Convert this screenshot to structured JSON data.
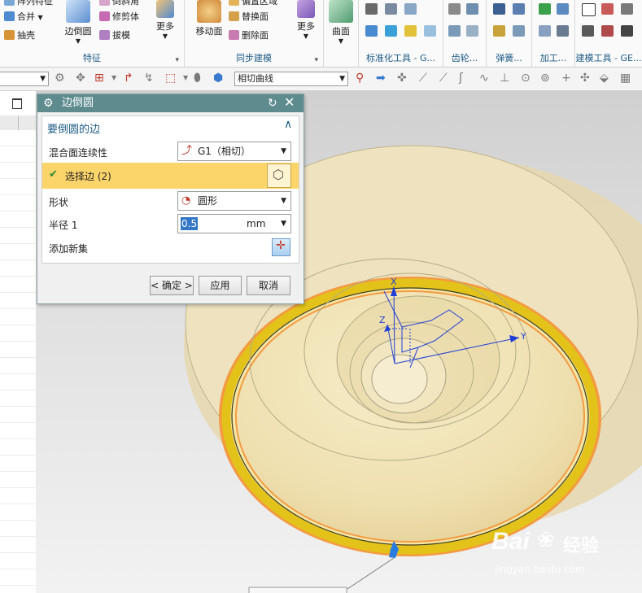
{
  "ribbon": {
    "group_feature": {
      "items": [
        "阵列特征",
        "合并",
        "抽壳"
      ],
      "big_button": "边倒圆",
      "items2": [
        "倒斜角",
        "修剪体",
        "拔模"
      ],
      "more": "更多",
      "label": "特征"
    },
    "group_sync": {
      "big_button": "移动面",
      "items": [
        "偏置区域",
        "替换面",
        "删除面"
      ],
      "more": "更多",
      "label": "同步建模"
    },
    "group_surface": {
      "big_button": "曲面"
    },
    "group_labels": [
      "标准化工具 - G...",
      "齿轮...",
      "弹簧...",
      "加工...",
      "建模工具 - GE..."
    ]
  },
  "toolbar2": {
    "selection_filter": "",
    "curve_rule": "相切曲线"
  },
  "dialog": {
    "title": "边倒圆",
    "section_title": "要倒圆的边",
    "continuity_label": "混合面连续性",
    "continuity_value": "G1（相切）",
    "select_edge_label": "选择边 (2)",
    "shape_label": "形状",
    "shape_value": "圆形",
    "radius_label": "半径 1",
    "radius_value": "0.5",
    "radius_unit": "mm",
    "add_set_label": "添加新集",
    "ok_button": "< 确定 >",
    "apply_button": "应用",
    "cancel_button": "取消"
  },
  "viewport": {
    "axis_x": "X",
    "axis_y": "Y",
    "axis_z": "Z"
  },
  "watermark": {
    "brand": "Bai",
    "brand2": "经验",
    "url": "jingyan.baidu.com"
  },
  "colors": {
    "dialog_title_bg": "#5e8c8e",
    "selected_row_bg": "#fbd46a",
    "ring_yellow": "#f0d21c",
    "ring_orange": "#f39a42",
    "part_body": "#e8d6a6",
    "accent_blue": "#1c5b86"
  }
}
